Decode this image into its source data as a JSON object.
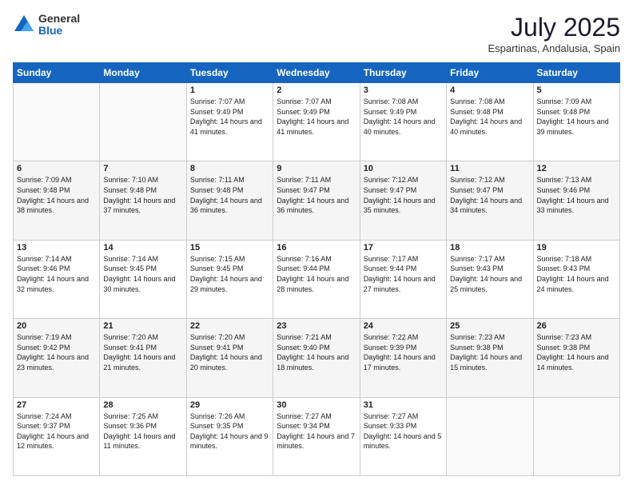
{
  "logo": {
    "general": "General",
    "blue": "Blue"
  },
  "header": {
    "month_year": "July 2025",
    "location": "Espartinas, Andalusia, Spain"
  },
  "weekdays": [
    "Sunday",
    "Monday",
    "Tuesday",
    "Wednesday",
    "Thursday",
    "Friday",
    "Saturday"
  ],
  "weeks": [
    [
      {
        "day": "",
        "sunrise": "",
        "sunset": "",
        "daylight": ""
      },
      {
        "day": "",
        "sunrise": "",
        "sunset": "",
        "daylight": ""
      },
      {
        "day": "1",
        "sunrise": "Sunrise: 7:07 AM",
        "sunset": "Sunset: 9:49 PM",
        "daylight": "Daylight: 14 hours and 41 minutes."
      },
      {
        "day": "2",
        "sunrise": "Sunrise: 7:07 AM",
        "sunset": "Sunset: 9:49 PM",
        "daylight": "Daylight: 14 hours and 41 minutes."
      },
      {
        "day": "3",
        "sunrise": "Sunrise: 7:08 AM",
        "sunset": "Sunset: 9:49 PM",
        "daylight": "Daylight: 14 hours and 40 minutes."
      },
      {
        "day": "4",
        "sunrise": "Sunrise: 7:08 AM",
        "sunset": "Sunset: 9:48 PM",
        "daylight": "Daylight: 14 hours and 40 minutes."
      },
      {
        "day": "5",
        "sunrise": "Sunrise: 7:09 AM",
        "sunset": "Sunset: 9:48 PM",
        "daylight": "Daylight: 14 hours and 39 minutes."
      }
    ],
    [
      {
        "day": "6",
        "sunrise": "Sunrise: 7:09 AM",
        "sunset": "Sunset: 9:48 PM",
        "daylight": "Daylight: 14 hours and 38 minutes."
      },
      {
        "day": "7",
        "sunrise": "Sunrise: 7:10 AM",
        "sunset": "Sunset: 9:48 PM",
        "daylight": "Daylight: 14 hours and 37 minutes."
      },
      {
        "day": "8",
        "sunrise": "Sunrise: 7:11 AM",
        "sunset": "Sunset: 9:48 PM",
        "daylight": "Daylight: 14 hours and 36 minutes."
      },
      {
        "day": "9",
        "sunrise": "Sunrise: 7:11 AM",
        "sunset": "Sunset: 9:47 PM",
        "daylight": "Daylight: 14 hours and 36 minutes."
      },
      {
        "day": "10",
        "sunrise": "Sunrise: 7:12 AM",
        "sunset": "Sunset: 9:47 PM",
        "daylight": "Daylight: 14 hours and 35 minutes."
      },
      {
        "day": "11",
        "sunrise": "Sunrise: 7:12 AM",
        "sunset": "Sunset: 9:47 PM",
        "daylight": "Daylight: 14 hours and 34 minutes."
      },
      {
        "day": "12",
        "sunrise": "Sunrise: 7:13 AM",
        "sunset": "Sunset: 9:46 PM",
        "daylight": "Daylight: 14 hours and 33 minutes."
      }
    ],
    [
      {
        "day": "13",
        "sunrise": "Sunrise: 7:14 AM",
        "sunset": "Sunset: 9:46 PM",
        "daylight": "Daylight: 14 hours and 32 minutes."
      },
      {
        "day": "14",
        "sunrise": "Sunrise: 7:14 AM",
        "sunset": "Sunset: 9:45 PM",
        "daylight": "Daylight: 14 hours and 30 minutes."
      },
      {
        "day": "15",
        "sunrise": "Sunrise: 7:15 AM",
        "sunset": "Sunset: 9:45 PM",
        "daylight": "Daylight: 14 hours and 29 minutes."
      },
      {
        "day": "16",
        "sunrise": "Sunrise: 7:16 AM",
        "sunset": "Sunset: 9:44 PM",
        "daylight": "Daylight: 14 hours and 28 minutes."
      },
      {
        "day": "17",
        "sunrise": "Sunrise: 7:17 AM",
        "sunset": "Sunset: 9:44 PM",
        "daylight": "Daylight: 14 hours and 27 minutes."
      },
      {
        "day": "18",
        "sunrise": "Sunrise: 7:17 AM",
        "sunset": "Sunset: 9:43 PM",
        "daylight": "Daylight: 14 hours and 25 minutes."
      },
      {
        "day": "19",
        "sunrise": "Sunrise: 7:18 AM",
        "sunset": "Sunset: 9:43 PM",
        "daylight": "Daylight: 14 hours and 24 minutes."
      }
    ],
    [
      {
        "day": "20",
        "sunrise": "Sunrise: 7:19 AM",
        "sunset": "Sunset: 9:42 PM",
        "daylight": "Daylight: 14 hours and 23 minutes."
      },
      {
        "day": "21",
        "sunrise": "Sunrise: 7:20 AM",
        "sunset": "Sunset: 9:41 PM",
        "daylight": "Daylight: 14 hours and 21 minutes."
      },
      {
        "day": "22",
        "sunrise": "Sunrise: 7:20 AM",
        "sunset": "Sunset: 9:41 PM",
        "daylight": "Daylight: 14 hours and 20 minutes."
      },
      {
        "day": "23",
        "sunrise": "Sunrise: 7:21 AM",
        "sunset": "Sunset: 9:40 PM",
        "daylight": "Daylight: 14 hours and 18 minutes."
      },
      {
        "day": "24",
        "sunrise": "Sunrise: 7:22 AM",
        "sunset": "Sunset: 9:39 PM",
        "daylight": "Daylight: 14 hours and 17 minutes."
      },
      {
        "day": "25",
        "sunrise": "Sunrise: 7:23 AM",
        "sunset": "Sunset: 9:38 PM",
        "daylight": "Daylight: 14 hours and 15 minutes."
      },
      {
        "day": "26",
        "sunrise": "Sunrise: 7:23 AM",
        "sunset": "Sunset: 9:38 PM",
        "daylight": "Daylight: 14 hours and 14 minutes."
      }
    ],
    [
      {
        "day": "27",
        "sunrise": "Sunrise: 7:24 AM",
        "sunset": "Sunset: 9:37 PM",
        "daylight": "Daylight: 14 hours and 12 minutes."
      },
      {
        "day": "28",
        "sunrise": "Sunrise: 7:25 AM",
        "sunset": "Sunset: 9:36 PM",
        "daylight": "Daylight: 14 hours and 11 minutes."
      },
      {
        "day": "29",
        "sunrise": "Sunrise: 7:26 AM",
        "sunset": "Sunset: 9:35 PM",
        "daylight": "Daylight: 14 hours and 9 minutes."
      },
      {
        "day": "30",
        "sunrise": "Sunrise: 7:27 AM",
        "sunset": "Sunset: 9:34 PM",
        "daylight": "Daylight: 14 hours and 7 minutes."
      },
      {
        "day": "31",
        "sunrise": "Sunrise: 7:27 AM",
        "sunset": "Sunset: 9:33 PM",
        "daylight": "Daylight: 14 hours and 5 minutes."
      },
      {
        "day": "",
        "sunrise": "",
        "sunset": "",
        "daylight": ""
      },
      {
        "day": "",
        "sunrise": "",
        "sunset": "",
        "daylight": ""
      }
    ]
  ]
}
